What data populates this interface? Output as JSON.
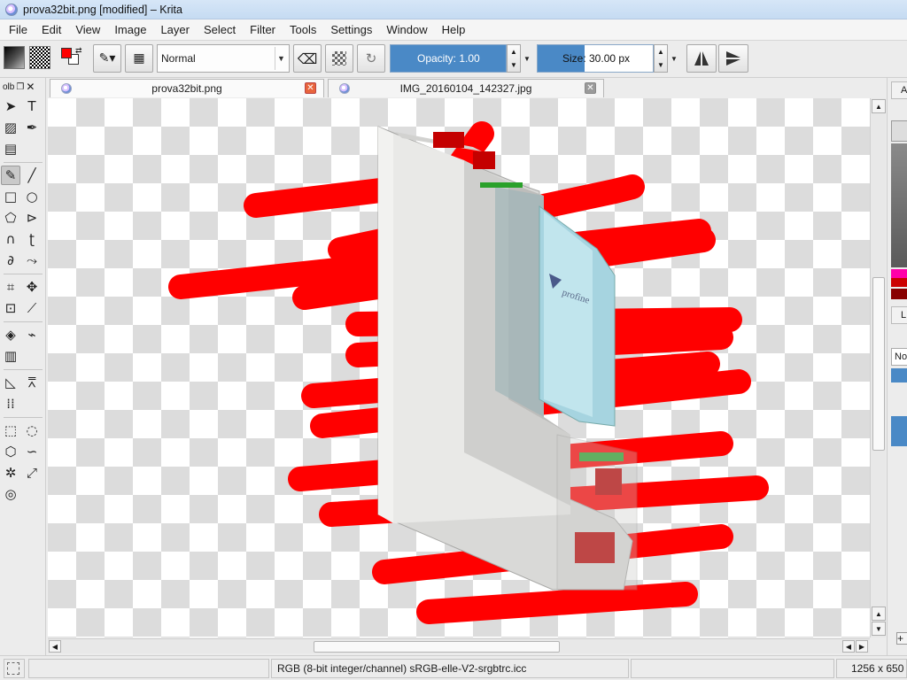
{
  "window": {
    "title": "prova32bit.png [modified] – Krita"
  },
  "menubar": {
    "items": [
      "File",
      "Edit",
      "View",
      "Image",
      "Layer",
      "Select",
      "Filter",
      "Tools",
      "Settings",
      "Window",
      "Help"
    ]
  },
  "toolbar": {
    "blend_mode": "Normal",
    "opacity_label": "Opacity:  1.00",
    "opacity_value": 1.0,
    "size_label": "Size:  30.00 px",
    "size_value": 30.0,
    "foreground_color": "#ff0000",
    "background_color": "#ffffff"
  },
  "toolbox": {
    "header_label": "olb",
    "active_tool": "freehand-brush-tool"
  },
  "tabs": [
    {
      "label": "prova32bit.png",
      "active": true
    },
    {
      "label": "IMG_20160104_142327.jpg",
      "active": false
    }
  ],
  "canvas": {
    "brush_color": "#ff0000",
    "image_content": "window-profile",
    "watermark": "profine"
  },
  "rightdock": {
    "letter_a": "A",
    "letter_l": "L",
    "mode_fragment": "No"
  },
  "statusbar": {
    "colorspace": "RGB (8-bit integer/channel)  sRGB-elle-V2-srgbtrc.icc",
    "dimensions": "1256 x 650 ("
  }
}
